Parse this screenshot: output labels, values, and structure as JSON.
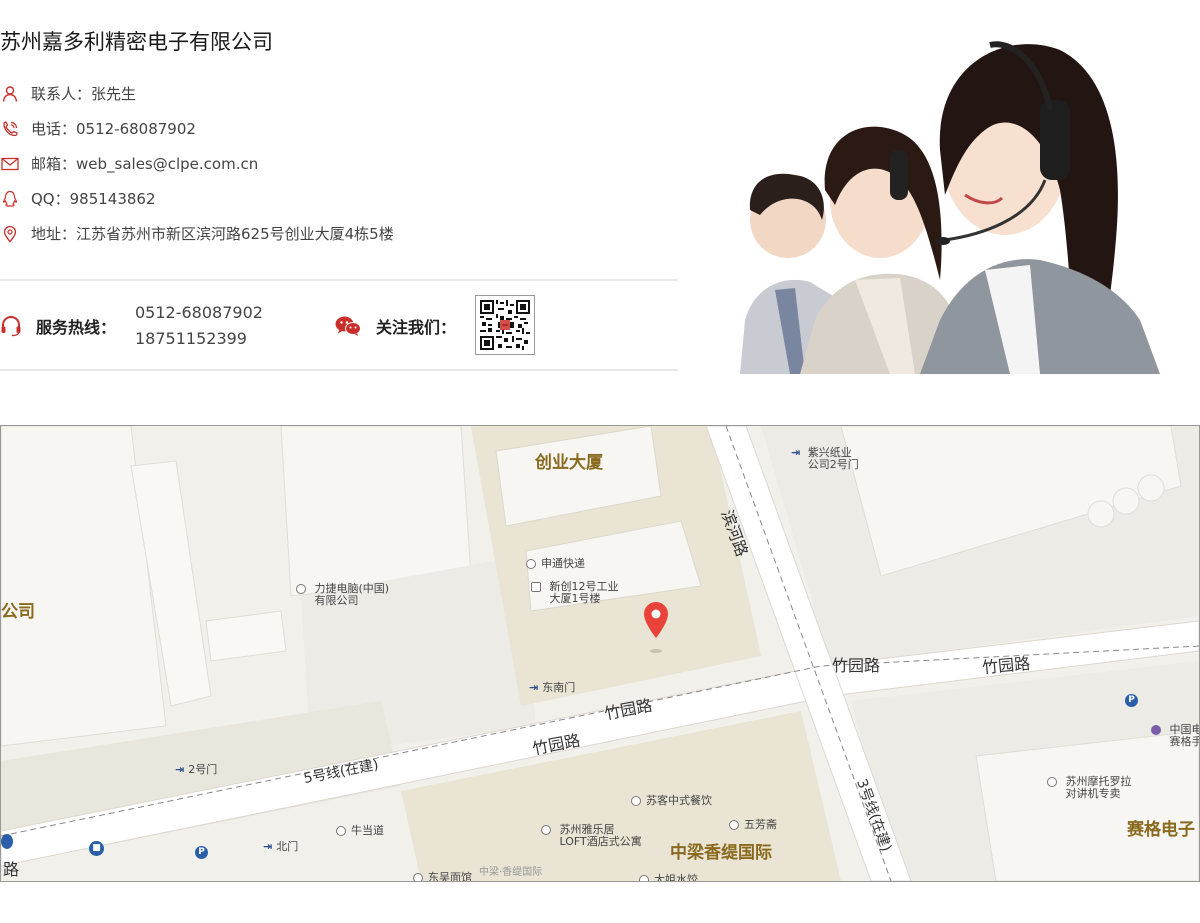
{
  "company_name": "苏州嘉多利精密电子有限公司",
  "contact": {
    "person": "联系人：张先生",
    "phone": "电话：0512-68087902",
    "email": "邮箱：web_sales@clpe.com.cn",
    "qq": "QQ：985143862",
    "address": "地址：江苏省苏州市新区滨河路625号创业大厦4栋5楼"
  },
  "hotline": {
    "label": "服务热线：",
    "numbers": [
      "0512-68087902",
      "18751152399"
    ]
  },
  "follow": {
    "label": "关注我们："
  },
  "icons": {
    "person": "person-icon",
    "phone": "phone-icon",
    "email": "envelope-icon",
    "qq": "qq-penguin-icon",
    "address": "location-pin-icon",
    "hotline": "headset-icon",
    "wechat": "wechat-icon"
  },
  "colors": {
    "accent": "#c9302c",
    "map_label": "#8a6a1f"
  },
  "map": {
    "buildings": [
      "创业大厦",
      "中梁香缇国际",
      "赛格电子"
    ],
    "left_edge_label": "公司",
    "roads": [
      "滨河路",
      "竹园路",
      "竹园路",
      "竹园路",
      "竹园路",
      "5号线(在建)",
      "3号线(在建)",
      "路"
    ],
    "pois": {
      "zixing": [
        "紫兴纸业",
        "公司2号门"
      ],
      "shentong": "申通快递",
      "xinchuang": [
        "新创12号工业",
        "大厦1号楼"
      ],
      "lijie": [
        "力捷电脑(中国)",
        "有限公司"
      ],
      "dongnanmen": "东南门",
      "gate2": "2号门",
      "beimen": "北门",
      "niudangdao": "牛当道",
      "suke": "苏客中式餐饮",
      "yale": [
        "苏州雅乐居",
        "LOFT酒店式公寓"
      ],
      "wufangzhai": "五芳斋",
      "motuoluola": [
        "苏州摩托罗拉",
        "对讲机专卖"
      ],
      "zhongguodian": [
        "中国电",
        "赛格手"
      ],
      "dongcheng": "东吴面馆",
      "xiangti_small": "中梁·香缇国际",
      "dajieshui": "大姐水饺"
    }
  }
}
